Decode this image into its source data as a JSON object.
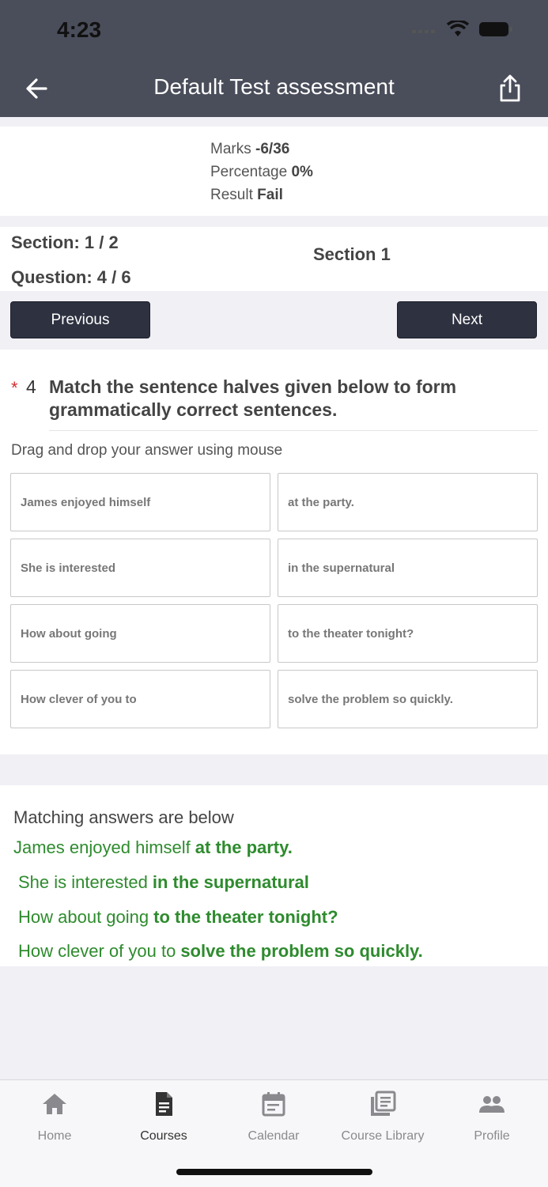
{
  "status_bar": {
    "time": "4:23"
  },
  "header": {
    "title": "Default Test assessment"
  },
  "marks": {
    "marks_label": "Marks",
    "marks_value": "-6/36",
    "percentage_label": "Percentage",
    "percentage_value": "0%",
    "result_label": "Result",
    "result_value": "Fail"
  },
  "section": {
    "section_text": "Section: 1 / 2",
    "question_text": "Question: 4 / 6",
    "section_name": "Section 1"
  },
  "nav": {
    "previous_label": "Previous",
    "next_label": "Next"
  },
  "question": {
    "required_mark": "*",
    "number": "4",
    "text": "Match the sentence halves given below to form grammatically correct sentences.",
    "hint": "Drag and drop your answer using mouse",
    "pairs": [
      {
        "left": "James enjoyed himself",
        "right": "at the party."
      },
      {
        "left": "She is interested",
        "right": "in the supernatural"
      },
      {
        "left": "How about going",
        "right": "to the theater tonight?"
      },
      {
        "left": "How clever of you to",
        "right": "solve the problem so quickly."
      }
    ]
  },
  "answers": {
    "title": "Matching answers are below",
    "rows": [
      {
        "left": "James enjoyed himself",
        "right": "at the party."
      },
      {
        "left": "She is interested",
        "right": "in the supernatural"
      },
      {
        "left": "How about going",
        "right": "to the theater tonight?"
      },
      {
        "left": "How clever of you to",
        "right": "solve the problem so quickly."
      }
    ]
  },
  "tabbar": {
    "items": [
      {
        "label": "Home",
        "icon": "home-icon"
      },
      {
        "label": "Courses",
        "icon": "document-icon"
      },
      {
        "label": "Calendar",
        "icon": "calendar-icon"
      },
      {
        "label": "Course Library",
        "icon": "library-icon"
      },
      {
        "label": "Profile",
        "icon": "people-icon"
      }
    ],
    "active": "Courses"
  },
  "colors": {
    "header": "#4a4d5a",
    "button": "#2e3140",
    "answer_green": "#2e8b2e",
    "required_red": "#d32f2f"
  }
}
